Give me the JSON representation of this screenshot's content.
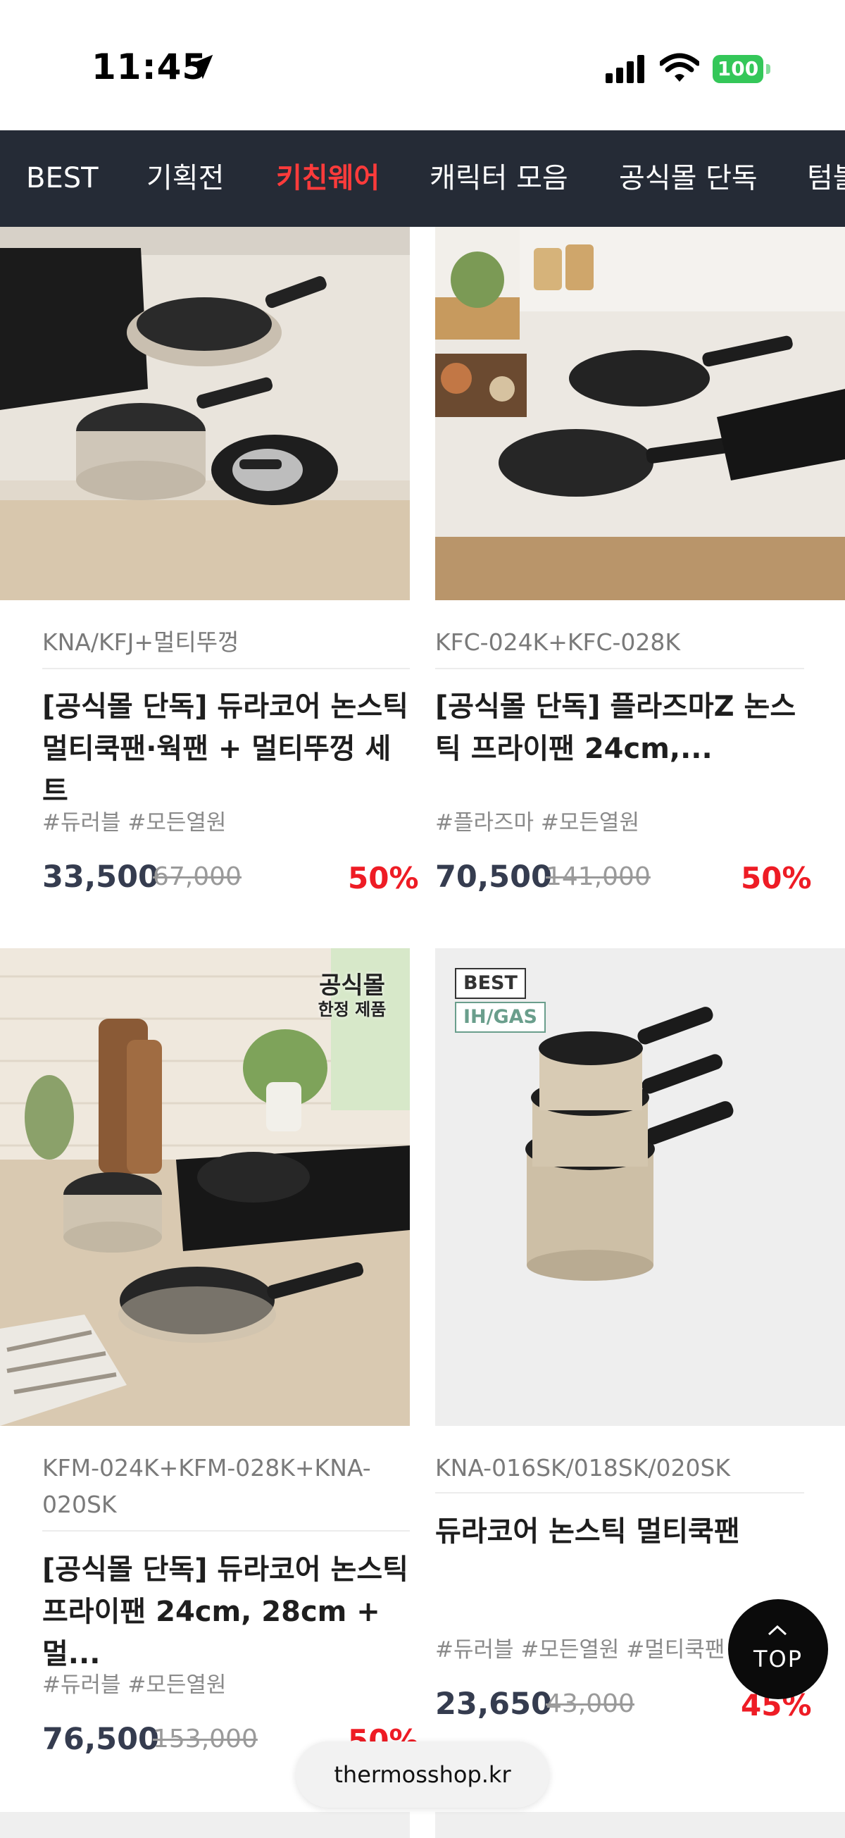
{
  "status_bar": {
    "time": "11:45",
    "battery": "100",
    "battery_color": "#34c759"
  },
  "nav": {
    "items": [
      "BEST",
      "기획전",
      "키친웨어",
      "캐릭터 모음",
      "공식몰 단독",
      "텀블"
    ],
    "active_index": 2,
    "active_color": "#ff3b3b",
    "background": "#252b36"
  },
  "products": [
    {
      "model": "KNA/KFJ+멀티뚜껑",
      "name": "[공식몰 단독] 듀라코어 논스틱 멀티쿡팬·웍팬 + 멀티뚜껑 세트",
      "tags": "#듀러블 #모든열원",
      "price": "33,500",
      "original_price": "67,000",
      "discount": "50%"
    },
    {
      "model": "KFC-024K+KFC-028K",
      "name": "[공식몰 단독] 플라즈마Z 논스틱 프라이팬 24cm,...",
      "tags": "#플라즈마 #모든열원",
      "price": "70,500",
      "original_price": "141,000",
      "discount": "50%"
    },
    {
      "model": "KFM-024K+KFM-028K+KNA-020SK",
      "name": "[공식몰 단독] 듀라코어 논스틱 프라이팬 24cm, 28cm + 멀...",
      "tags": "#듀러블 #모든열원",
      "price": "76,500",
      "original_price": "153,000",
      "discount": "50%",
      "image_label": {
        "line1": "공식몰",
        "line2": "한정 제품"
      }
    },
    {
      "model": "KNA-016SK/018SK/020SK",
      "name": "듀라코어 논스틱 멀티쿡팬",
      "tags": "#듀러블 #모든열원 #멀티쿡팬",
      "price": "23,650",
      "original_price": "43,000",
      "discount": "45%",
      "badges": [
        "BEST",
        "IH/GAS"
      ]
    }
  ],
  "top_button": {
    "label": "TOP"
  },
  "browser": {
    "url": "thermosshop.kr"
  },
  "colors": {
    "price": "#353c4f",
    "discount": "#ee1c25",
    "badge_ih": "#6a9e8c"
  },
  "icons": [
    "location-arrow-icon",
    "signal-icon",
    "wifi-icon",
    "battery-icon",
    "chevron-up-icon"
  ]
}
